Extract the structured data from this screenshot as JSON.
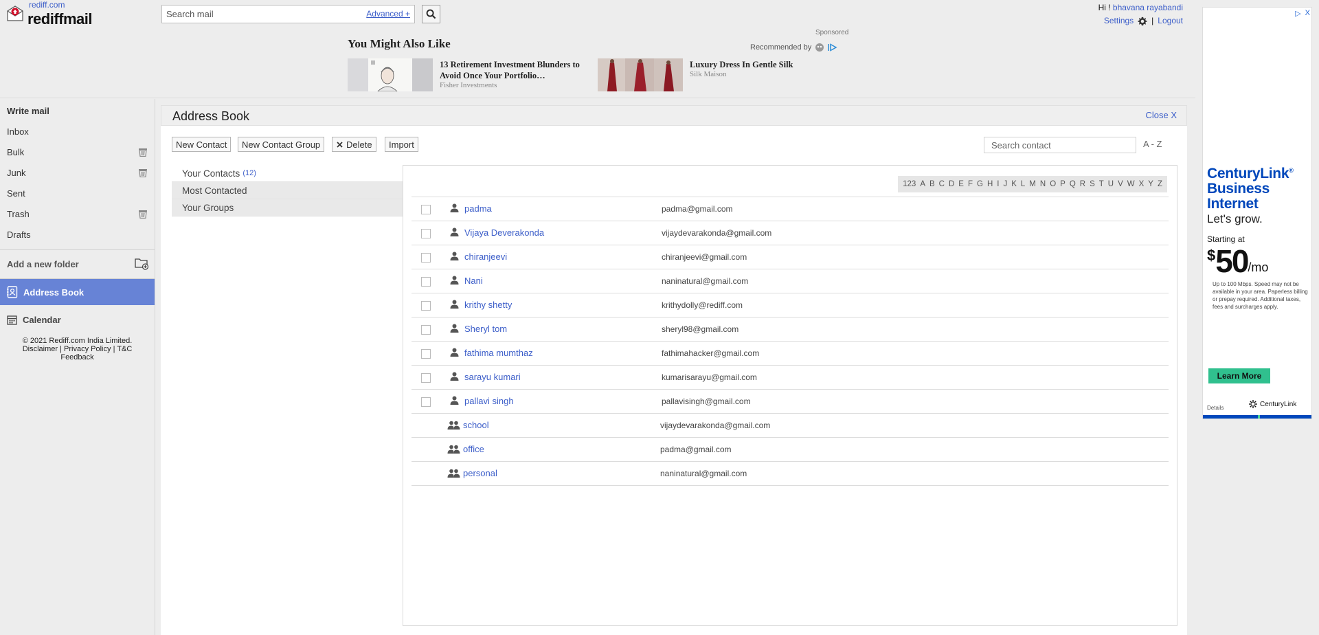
{
  "header": {
    "logo_small": "rediff.com",
    "logo_text": "rediffmail",
    "search_placeholder": "Search mail",
    "advanced_label": "Advanced +",
    "greeting": "Hi !",
    "user_name": "bhavana rayabandi",
    "settings_label": "Settings",
    "logout_label": "Logout",
    "separator": "|"
  },
  "promo": {
    "title": "You Might Also Like",
    "sponsored_label": "Sponsored",
    "recommended_label": "Recommended by",
    "items": [
      {
        "title": "13 Retirement Investment Blunders to Avoid Once Your Portfolio…",
        "source": "Fisher Investments"
      },
      {
        "title": "Luxury Dress In Gentle Silk",
        "source": "Silk Maison"
      }
    ]
  },
  "nav": {
    "items": [
      {
        "label": "Write mail"
      },
      {
        "label": "Inbox"
      },
      {
        "label": "Bulk"
      },
      {
        "label": "Junk"
      },
      {
        "label": "Sent"
      },
      {
        "label": "Trash"
      },
      {
        "label": "Drafts"
      }
    ],
    "add_folder_label": "Add a new folder",
    "address_book_label": "Address Book",
    "calendar_label": "Calendar",
    "copyright": "© 2021 Rediff.com India Limited.",
    "disclaimer": "Disclaimer",
    "privacy": "Privacy Policy",
    "tc": "T&C",
    "feedback": "Feedback",
    "link_sep": "|"
  },
  "address_book": {
    "title": "Address Book",
    "close_label": "Close X",
    "toolbar": {
      "new_contact": "New Contact",
      "new_group": "New Contact Group",
      "delete": "Delete",
      "import": "Import"
    },
    "search_placeholder": "Search contact",
    "sort_label": "A - Z",
    "categories": {
      "your_contacts": "Your Contacts",
      "your_contacts_count": "(12)",
      "most_contacted": "Most Contacted",
      "your_groups": "Your Groups"
    },
    "alphabet": [
      "123",
      "A",
      "B",
      "C",
      "D",
      "E",
      "F",
      "G",
      "H",
      "I",
      "J",
      "K",
      "L",
      "M",
      "N",
      "O",
      "P",
      "Q",
      "R",
      "S",
      "T",
      "U",
      "V",
      "W",
      "X",
      "Y",
      "Z"
    ],
    "contacts": [
      {
        "name": "padma",
        "email": "padma@gmail.com"
      },
      {
        "name": "Vijaya Deverakonda",
        "email": "vijaydevarakonda@gmail.com"
      },
      {
        "name": "chiranjeevi",
        "email": "chiranjeevi@gmail.com"
      },
      {
        "name": "Nani",
        "email": "naninatural@gmail.com"
      },
      {
        "name": "krithy shetty",
        "email": "krithydolly@rediff.com"
      },
      {
        "name": "Sheryl tom",
        "email": "sheryl98@gmail.com"
      },
      {
        "name": "fathima mumthaz",
        "email": "fathimahacker@gmail.com"
      },
      {
        "name": "sarayu kumari",
        "email": "kumarisarayu@gmail.com"
      },
      {
        "name": "pallavi singh",
        "email": "pallavisingh@gmail.com"
      }
    ],
    "groups": [
      {
        "name": "school",
        "email": "vijaydevarakonda@gmail.com"
      },
      {
        "name": "office",
        "email": "padma@gmail.com"
      },
      {
        "name": "personal",
        "email": "naninatural@gmail.com"
      }
    ]
  },
  "ad": {
    "brand_line1": "CenturyLink",
    "brand_mark": "®",
    "brand_line2": "Business",
    "brand_line3": "Internet",
    "tagline": "Let's grow.",
    "starting_at": "Starting at",
    "price_currency": "$",
    "price_amount": "50",
    "price_period": "/mo",
    "fine_print": "Up to 100 Mbps. Speed may not be available in your area. Paperless billing or prepay required. Additional taxes, fees and surcharges apply.",
    "cta": "Learn More",
    "details": "Details",
    "logo_text": "CenturyLink",
    "adchoices": "▷",
    "close": "X",
    "accent": "#0047bb"
  },
  "colors": {
    "link": "#3c5ec9",
    "nav_active": "#6783d6"
  }
}
